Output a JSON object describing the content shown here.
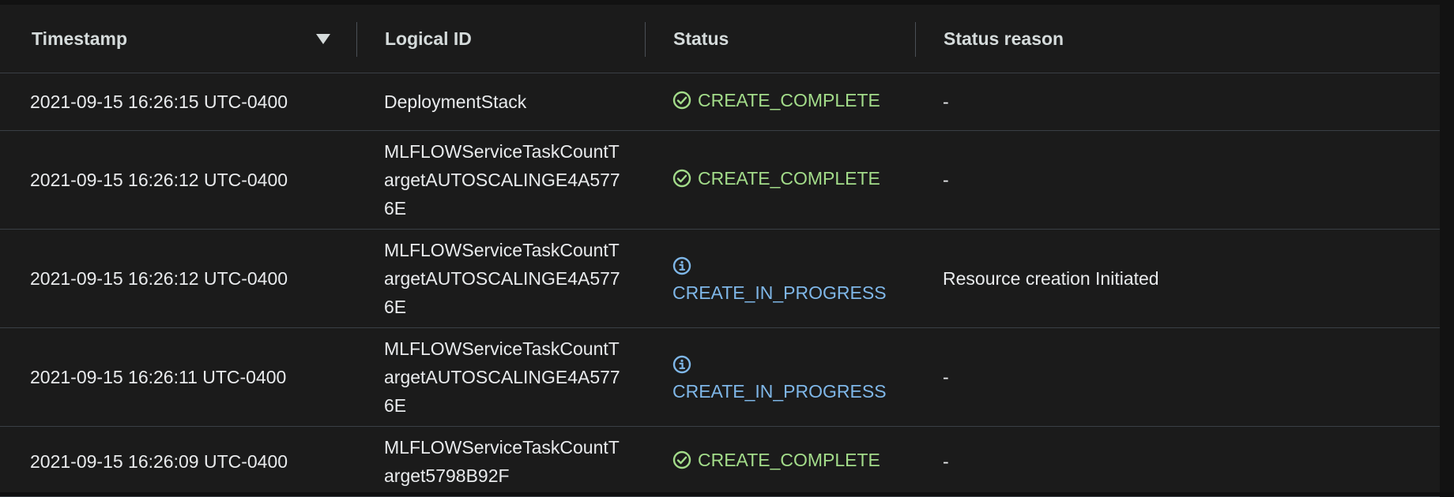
{
  "table": {
    "headers": {
      "timestamp": "Timestamp",
      "logical_id": "Logical ID",
      "status": "Status",
      "status_reason": "Status reason"
    },
    "sort_direction": "descending",
    "rows": [
      {
        "timestamp": "2021-09-15 16:26:15 UTC-0400",
        "logical_id": "DeploymentStack",
        "status": "CREATE_COMPLETE",
        "status_icon": "check-circle-icon",
        "status_reason": "-"
      },
      {
        "timestamp": "2021-09-15 16:26:12 UTC-0400",
        "logical_id": "MLFLOWServiceTaskCountTargetAUTOSCALINGE4A5776E",
        "status": "CREATE_COMPLETE",
        "status_icon": "check-circle-icon",
        "status_reason": "-"
      },
      {
        "timestamp": "2021-09-15 16:26:12 UTC-0400",
        "logical_id": "MLFLOWServiceTaskCountTargetAUTOSCALINGE4A5776E",
        "status": "CREATE_IN_PROGRESS",
        "status_icon": "info-circle-icon",
        "status_reason": "Resource creation Initiated"
      },
      {
        "timestamp": "2021-09-15 16:26:11 UTC-0400",
        "logical_id": "MLFLOWServiceTaskCountTargetAUTOSCALINGE4A5776E",
        "status": "CREATE_IN_PROGRESS",
        "status_icon": "info-circle-icon",
        "status_reason": "-"
      },
      {
        "timestamp": "2021-09-15 16:26:09 UTC-0400",
        "logical_id": "MLFLOWServiceTaskCountTarget5798B92F",
        "status": "CREATE_COMPLETE",
        "status_icon": "check-circle-icon",
        "status_reason": "-"
      }
    ]
  },
  "colors": {
    "complete": "#a3dc8a",
    "in_progress": "#7fb7e8",
    "background": "#1b1b1b",
    "text": "#e9ebed"
  }
}
